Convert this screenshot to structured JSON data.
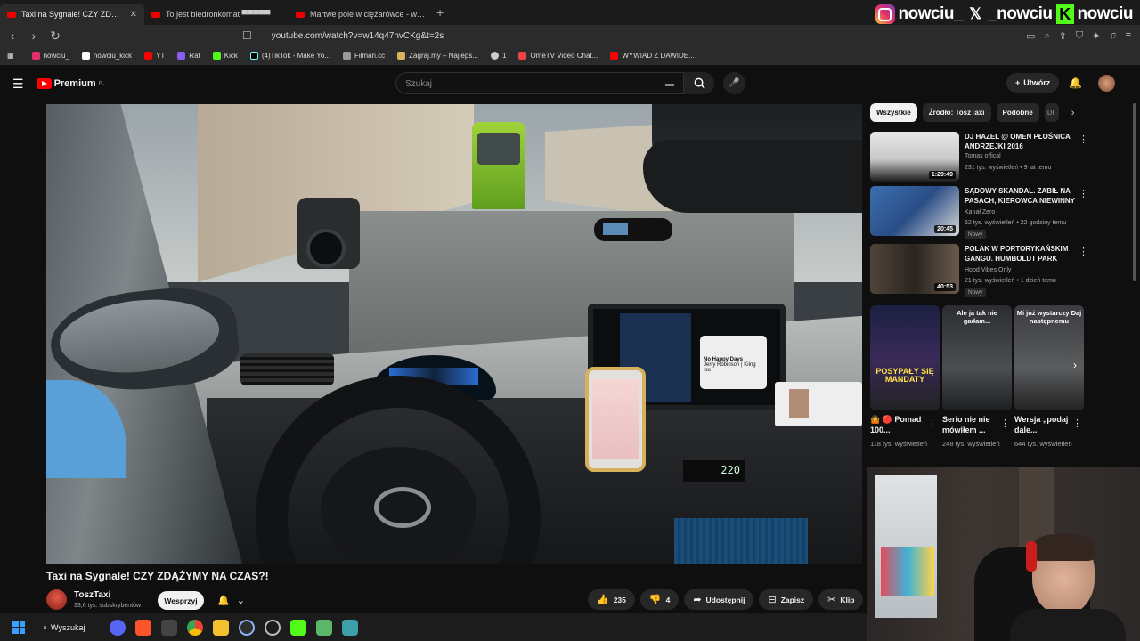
{
  "browser": {
    "tabs": [
      {
        "label": "Taxi na Sygnale! CZY ZDĄŻYM",
        "active": true
      },
      {
        "label": "To jest biedronkomat ▀▀▀▀▀",
        "active": false
      },
      {
        "label": "Martwe pole w ciężarówce - w pr",
        "active": false
      }
    ],
    "url": "youtube.com/watch?v=w14q47nvCKg&t=2s",
    "bookmarks": [
      "nowciu_",
      "nowciu_kick",
      "YT",
      "Rat",
      "Kick",
      "(4)TikTok - Make Yo...",
      "Filman.cc",
      "Zagraj.my – Najleps...",
      "1",
      "OmeTV Video Chat...",
      "WYWIAD Z DAWIDE..."
    ]
  },
  "overlay": {
    "instagram": "nowciu_",
    "x": "_nowciu",
    "kick": "nowciu"
  },
  "youtube": {
    "logo": "Premium",
    "logo_region": "PL",
    "search_placeholder": "Szukaj",
    "create_label": "Utwórz"
  },
  "video": {
    "title": "Taxi na Sygnale! CZY ZDĄŻYMY NA CZAS?!",
    "channel": "ToszTaxi",
    "subscribers": "33,6 tys. subskrybentów",
    "support_label": "Wesprzyj",
    "likes": "235",
    "dislikes": "4",
    "share_label": "Udostępnij",
    "save_label": "Zapisz",
    "clip_label": "Klip",
    "dashboard_display": "220",
    "carplay_song": "No Happy Days",
    "carplay_artist": "Jerry Robinson | Kiing Iso"
  },
  "sidebar": {
    "chips": [
      "Wszystkie",
      "Źródło: ToszTaxi",
      "Podobne",
      "Dl"
    ],
    "recommendations": [
      {
        "title": "DJ HAZEL @ OMEN PŁOŚNICA ANDRZEJKI 2016",
        "channel": "Tomas offical",
        "meta": "231 tys. wyświetleń • 9 lat temu",
        "duration": "1:29:49",
        "badge": ""
      },
      {
        "title": "SĄDOWY SKANDAL. ZABIŁ NA PASACH, KIEROWCA NIEWINNY",
        "channel": "Kanał Zero",
        "meta": "62 tys. wyświetleń • 22 godziny temu",
        "duration": "20:45",
        "badge": "Nowy"
      },
      {
        "title": "POLAK W PORTORYKAŃSKIM GANGU. HUMBOLDT PARK",
        "channel": "Hood Vibes Only",
        "meta": "21 tys. wyświetleń • 1 dzień temu",
        "duration": "40:53",
        "badge": "Nowy"
      }
    ],
    "shorts": [
      {
        "title": "🤷 🔴 Pomad 100...",
        "views": "118 tys. wyświetleń",
        "caption": "POSYPAŁY SIĘ MANDATY"
      },
      {
        "title": "Serio nie nie mówiłem ...",
        "views": "248 tys. wyświetleń",
        "caption": "Ale ja tak nie gadam..."
      },
      {
        "title": "Wersja „podaj dale...",
        "views": "644 tys. wyświetleń",
        "caption": "Mi już wystarczy Daj następnemu"
      }
    ]
  },
  "taskbar": {
    "search_label": "Wyszukaj"
  }
}
